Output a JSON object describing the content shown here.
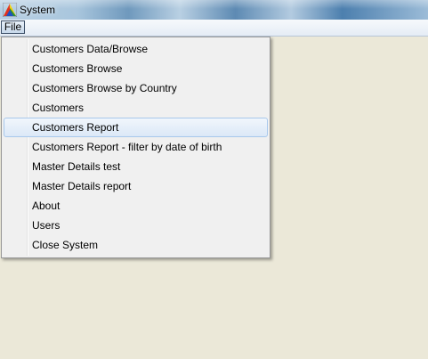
{
  "window": {
    "title": "System",
    "icon": "app-colorful-icon"
  },
  "menubar": {
    "items": [
      {
        "label": "File",
        "state": "open"
      }
    ]
  },
  "file_menu": {
    "highlighted_index": 4,
    "items": [
      {
        "label": "Customers Data/Browse"
      },
      {
        "label": "Customers Browse"
      },
      {
        "label": "Customers Browse by Country"
      },
      {
        "label": "Customers"
      },
      {
        "label": "Customers Report"
      },
      {
        "label": "Customers Report - filter by date of birth"
      },
      {
        "label": "Master Details test"
      },
      {
        "label": "Master Details report"
      },
      {
        "label": "About"
      },
      {
        "label": "Users"
      },
      {
        "label": "Close System"
      }
    ]
  },
  "colors": {
    "client_background": "#ebe8d8",
    "menu_background": "#f0f0f0",
    "highlight_border": "#a8c8ec"
  }
}
